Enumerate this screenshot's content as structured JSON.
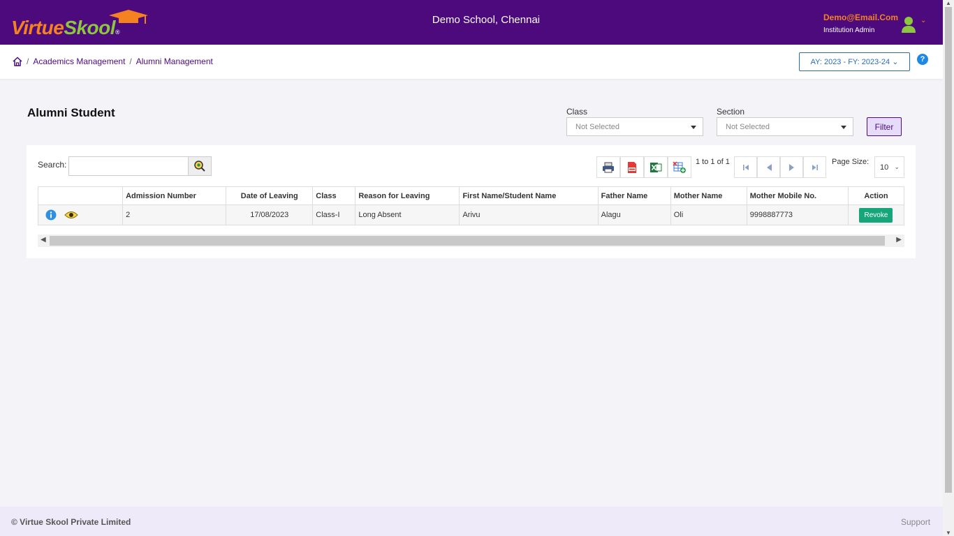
{
  "header": {
    "logo_part1": "Virtue",
    "logo_part2": "Skool",
    "logo_reg": "®",
    "school_name": "Demo School, Chennai",
    "user_email": "Demo@Email.Com",
    "user_role": "Institution Admin",
    "user_chevron": "⌄"
  },
  "breadcrumb": {
    "items": [
      "Academics Management",
      "Alumni Management"
    ],
    "separator": "/"
  },
  "year_selector": {
    "label": "AY: 2023 - FY: 2023-24 ⌄"
  },
  "help_label": "?",
  "page": {
    "title": "Alumni Student",
    "class_label": "Class",
    "class_value": "Not Selected",
    "section_label": "Section",
    "section_value": "Not Selected",
    "filter_label": "Filter"
  },
  "grid": {
    "search_label": "Search:",
    "search_value": "",
    "pager_text": "1 to 1 of 1",
    "page_size_label": "Page Size:",
    "page_size_value": "10",
    "columns": [
      "",
      "Admission Number",
      "Date of Leaving",
      "Class",
      "Reason for Leaving",
      "First Name/Student Name",
      "Father Name",
      "Mother Name",
      "Mother Mobile No.",
      "Action"
    ],
    "rows": [
      {
        "admission_number": "2",
        "date_of_leaving": "17/08/2023",
        "class": "Class-I",
        "reason": "Long Absent",
        "student_name": "Arivu",
        "father_name": "Alagu",
        "mother_name": "Oli",
        "mother_mobile": "9998887773",
        "action_label": "Revoke"
      }
    ]
  },
  "footer": {
    "copyright": "© Virtue Skool Private Limited",
    "support": "Support"
  },
  "colors": {
    "brand_purple": "#4c0a7d",
    "brand_orange": "#f58220",
    "brand_green": "#8dc63f",
    "revoke_green": "#16a679",
    "link_blue": "#2b6cb0"
  },
  "icons": [
    "graduation-cap-icon",
    "user-avatar-icon",
    "home-icon",
    "help-icon",
    "search-icon",
    "print-icon",
    "pdf-icon",
    "excel-icon",
    "export-sheet-icon",
    "first-page-icon",
    "prev-page-icon",
    "next-page-icon",
    "last-page-icon",
    "info-icon",
    "view-eye-icon"
  ]
}
